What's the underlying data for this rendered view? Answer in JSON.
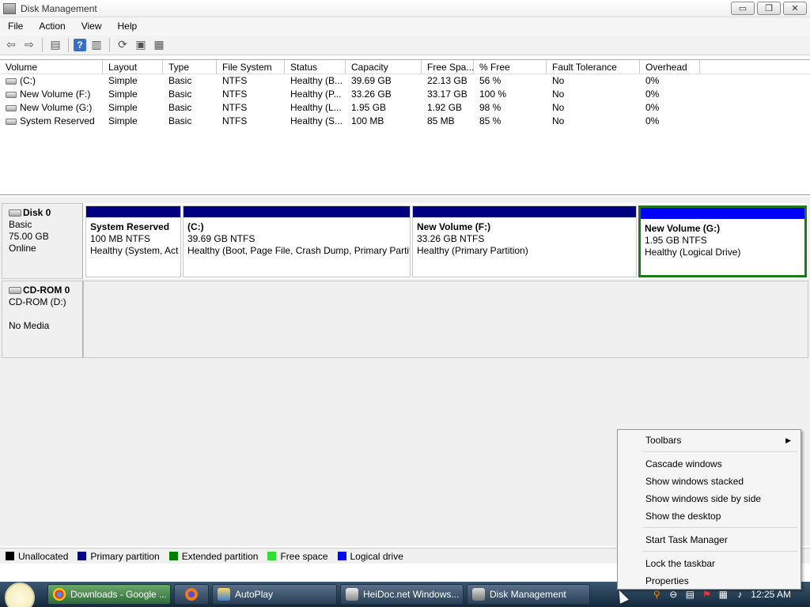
{
  "window": {
    "title": "Disk Management",
    "min_glyph": "▭",
    "max_glyph": "❐",
    "close_glyph": "✕"
  },
  "menu": {
    "items": [
      "File",
      "Action",
      "View",
      "Help"
    ]
  },
  "toolbar": {
    "buttons": [
      "back-icon",
      "forward-icon",
      "console-tree-icon",
      "help-icon",
      "action-pane-icon",
      "refresh-icon",
      "properties-icon",
      "export-icon"
    ]
  },
  "volume_table": {
    "columns": [
      "Volume",
      "Layout",
      "Type",
      "File System",
      "Status",
      "Capacity",
      "Free Spa...",
      "% Free",
      "Fault Tolerance",
      "Overhead"
    ],
    "rows": [
      [
        "(C:)",
        "Simple",
        "Basic",
        "NTFS",
        "Healthy (B...",
        "39.69 GB",
        "22.13 GB",
        "56 %",
        "No",
        "0%"
      ],
      [
        "New Volume (F:)",
        "Simple",
        "Basic",
        "NTFS",
        "Healthy (P...",
        "33.26 GB",
        "33.17 GB",
        "100 %",
        "No",
        "0%"
      ],
      [
        "New Volume (G:)",
        "Simple",
        "Basic",
        "NTFS",
        "Healthy (L...",
        "1.95 GB",
        "1.92 GB",
        "98 %",
        "No",
        "0%"
      ],
      [
        "System Reserved",
        "Simple",
        "Basic",
        "NTFS",
        "Healthy (S...",
        "100 MB",
        "85 MB",
        "85 %",
        "No",
        "0%"
      ]
    ]
  },
  "disk0": {
    "name": "Disk 0",
    "type": "Basic",
    "size": "75.00 GB",
    "state": "Online",
    "partitions": [
      {
        "name": "System Reserved",
        "size": "100 MB NTFS",
        "status": "Healthy (System, Act"
      },
      {
        "name": "(C:)",
        "size": "39.69 GB NTFS",
        "status": "Healthy (Boot, Page File, Crash Dump, Primary Partit"
      },
      {
        "name": "New Volume  (F:)",
        "size": "33.26 GB NTFS",
        "status": "Healthy (Primary Partition)"
      },
      {
        "name": "New Volume  (G:)",
        "size": "1.95 GB NTFS",
        "status": "Healthy (Logical Drive)"
      }
    ]
  },
  "cdrom0": {
    "name": "CD-ROM 0",
    "drive": "CD-ROM (D:)",
    "media": "No Media"
  },
  "legend": [
    {
      "label": "Unallocated",
      "color": "#000000"
    },
    {
      "label": "Primary partition",
      "color": "#000080"
    },
    {
      "label": "Extended partition",
      "color": "#008000"
    },
    {
      "label": "Free space",
      "color": "#33dd33"
    },
    {
      "label": "Logical drive",
      "color": "#0000ff"
    }
  ],
  "taskbar": {
    "tasks": [
      {
        "label": "Downloads - Google ...",
        "icon": "chrome-icon"
      },
      {
        "label": "",
        "icon": "firefox-icon"
      },
      {
        "label": "AutoPlay",
        "icon": "autoplay-icon"
      },
      {
        "label": "HeiDoc.net Windows...",
        "icon": "heidoc-icon"
      },
      {
        "label": "Disk Management",
        "icon": "disk-management-icon"
      }
    ],
    "clock": "12:25 AM"
  },
  "context_menu": {
    "toolbars": "Toolbars",
    "cascade": "Cascade windows",
    "stacked": "Show windows stacked",
    "side_by_side": "Show windows side by side",
    "desktop": "Show the desktop",
    "task_manager": "Start Task Manager",
    "lock": "Lock the taskbar",
    "properties": "Properties"
  },
  "colors": {
    "primary": "#000080",
    "logical": "#0000ff",
    "selected_border": "#1a7a1a"
  }
}
